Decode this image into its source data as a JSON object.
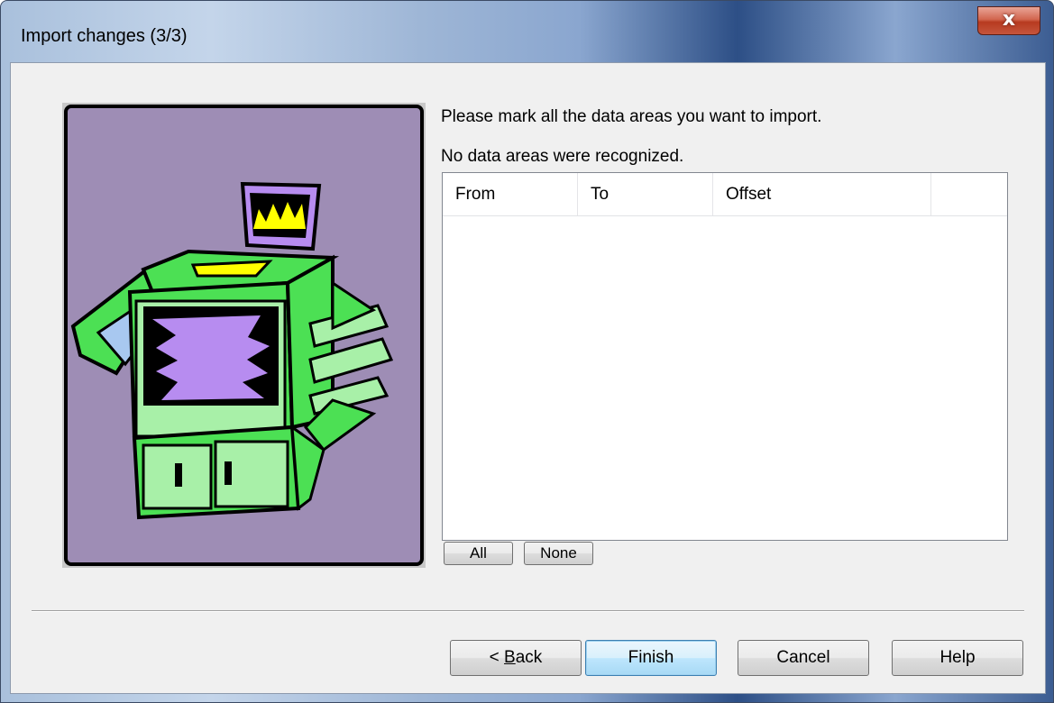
{
  "window": {
    "title": "Import changes (3/3)",
    "close_label": "x"
  },
  "messages": {
    "instruction": "Please mark all the data areas you want to import.",
    "status": "No data areas were recognized."
  },
  "table": {
    "columns": [
      "From",
      "To",
      "Offset",
      ""
    ],
    "rows": []
  },
  "selection_buttons": {
    "all": "All",
    "none": "None"
  },
  "footer": {
    "back_prefix": "< ",
    "back_mnemonic": "B",
    "back_rest": "ack",
    "finish": "Finish",
    "cancel": "Cancel",
    "help": "Help"
  },
  "colors": {
    "wizard_background": "#9e8db5",
    "machine_green": "#4ce054",
    "machine_light_green": "#a8f0a8",
    "screen_purple": "#b78cf0",
    "flame_yellow": "#ffff00"
  },
  "icons": {
    "wizard_image": "copier-machine-illustration"
  }
}
